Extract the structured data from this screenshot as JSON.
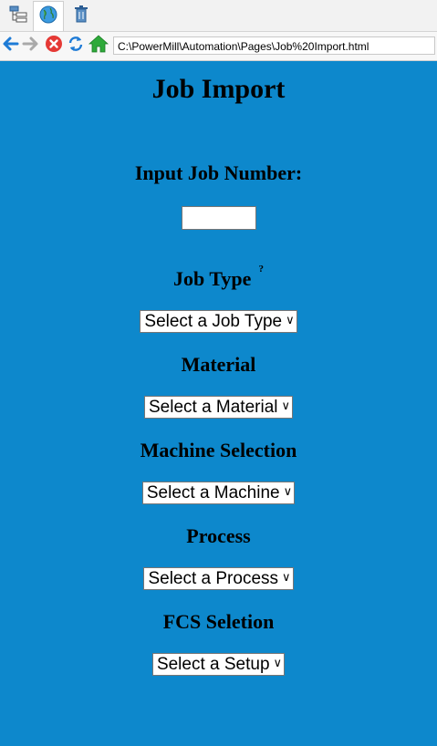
{
  "browser": {
    "address": "C:\\PowerMill\\Automation\\Pages\\Job%20Import.html"
  },
  "page": {
    "title": "Job Import",
    "job_number_label": "Input Job Number:",
    "job_number_value": "",
    "job_type_label": "Job Type",
    "job_type_help": "?",
    "job_type_select": "Select a Job Type",
    "material_label": "Material",
    "material_select": "Select a Material",
    "machine_label": "Machine Selection",
    "machine_select": "Select a Machine",
    "process_label": "Process",
    "process_select": "Select a Process",
    "fcs_label": "FCS Seletion",
    "fcs_select": "Select a Setup"
  },
  "colors": {
    "page_background": "#0d88cc"
  }
}
